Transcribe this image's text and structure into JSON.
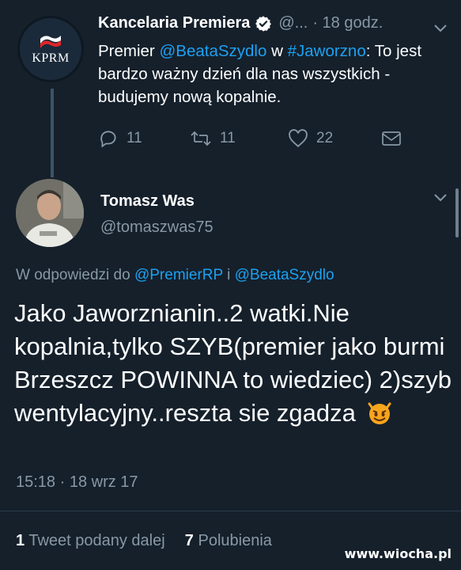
{
  "tweet1": {
    "avatar_text": "KPRM",
    "display_name": "Kancelaria Premiera",
    "handle": "@...",
    "time": "· 18 godz.",
    "text_mention": "@BeataSzydlo",
    "text_hashtag": "#Jaworzno",
    "text_prefix": "Premier ",
    "text_mid": " w ",
    "text_line1_end": ": To",
    "text_rest": "jest bardzo ważny dzień dla nas wszystkich - budujemy nową kopalnie.",
    "replies": "11",
    "retweets": "11",
    "likes": "22"
  },
  "tweet2": {
    "display_name": "Tomasz Was",
    "handle": "@tomaszwas75",
    "reply_prefix": "W odpowiedzi do ",
    "reply_user1": "@PremierRP",
    "reply_conj": " i ",
    "reply_user2": "@BeataSzydlo",
    "text": "Jako Jaworznianin..2 watki.Nie kopalnia,tylko SZYB(premier jako burmi Brzeszcz POWINNA to wiedziec) 2)szyb wentylacyjny..reszta sie zgadza",
    "emoji": "smiling-devil",
    "timestamp": "15:18 · 18 wrz 17",
    "retweet_count": "1",
    "retweet_label": "Tweet podany dalej",
    "like_count": "7",
    "like_label": "Polubienia"
  },
  "watermark": "www.wiocha.pl",
  "colors": {
    "background": "#15202b",
    "accent": "#1da1f2",
    "muted": "#8899a6"
  }
}
